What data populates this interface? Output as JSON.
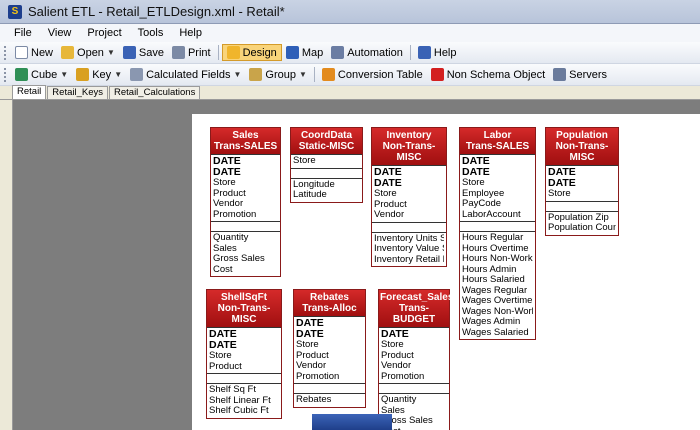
{
  "window": {
    "title": "Salient ETL - Retail_ETLDesign.xml - Retail*"
  },
  "menu": [
    "File",
    "View",
    "Project",
    "Tools",
    "Help"
  ],
  "toolbar1": [
    {
      "label": "New",
      "icon": "new-icon",
      "color": "#ffffff"
    },
    {
      "label": "Open",
      "icon": "open-icon",
      "color": "#e7b73a",
      "dropdown": true
    },
    {
      "label": "Save",
      "icon": "save-icon",
      "color": "#3a62b5"
    },
    {
      "label": "Print",
      "icon": "print-icon",
      "color": "#7c8aa5"
    },
    {
      "label": "Design",
      "icon": "design-icon",
      "color": "#f0b52c",
      "active": true
    },
    {
      "label": "Map",
      "icon": "map-icon",
      "color": "#2f5fb8"
    },
    {
      "label": "Automation",
      "icon": "automation-icon",
      "color": "#6b7da3"
    },
    {
      "label": "Help",
      "icon": "help-icon",
      "color": "#3a62b5"
    }
  ],
  "toolbar2": [
    {
      "label": "Cube",
      "icon": "cube-icon",
      "color": "#2f8f56",
      "dropdown": true
    },
    {
      "label": "Key",
      "icon": "key-icon",
      "color": "#d9a021",
      "dropdown": true
    },
    {
      "label": "Calculated Fields",
      "icon": "calculated-fields-icon",
      "color": "#8a97b0",
      "dropdown": true
    },
    {
      "label": "Group",
      "icon": "group-icon",
      "color": "#c9a44a",
      "dropdown": true
    },
    {
      "label": "Conversion Table",
      "icon": "conversion-table-icon",
      "color": "#e38b1e"
    },
    {
      "label": "Non Schema Object",
      "icon": "non-schema-object-icon",
      "color": "#d31f1f"
    },
    {
      "label": "Servers",
      "icon": "servers-icon",
      "color": "#6a7b9c"
    }
  ],
  "tabs": [
    "Retail",
    "Retail_Keys",
    "Retail_Calculations"
  ],
  "tables": [
    {
      "title1": "Sales",
      "title2": "Trans-SALES",
      "bold": [
        "DATE",
        "DATE"
      ],
      "keys": [
        "Store",
        "Product",
        "Vendor",
        "Promotion"
      ],
      "measures": [
        "Quantity",
        "Sales",
        "Gross Sales",
        "Cost"
      ]
    },
    {
      "title1": "CoordData",
      "title2": "Static-MISC",
      "bold": [],
      "keys": [
        "Store"
      ],
      "measures": [
        "Longitude",
        "Latitude"
      ]
    },
    {
      "title1": "Inventory",
      "title2": "Non-Trans-MISC",
      "bold": [
        "DATE",
        "DATE"
      ],
      "keys": [
        "Store",
        "Product",
        "Vendor"
      ],
      "measures": [
        "Inventory Units Shelf",
        "Inventory Value Shelf",
        "Inventory Retail Price"
      ]
    },
    {
      "title1": "Labor",
      "title2": "Trans-SALES",
      "bold": [
        "DATE",
        "DATE"
      ],
      "keys": [
        "Store",
        "Employee",
        "PayCode",
        "LaborAccount"
      ],
      "measures": [
        "Hours Regular",
        "Hours Overtime",
        "Hours Non-Worked",
        "Hours Admin",
        "Hours Salaried",
        "Wages Regular",
        "Wages Overtime",
        "Wages Non-Worked",
        "Wages Admin",
        "Wages Salaried"
      ]
    },
    {
      "title1": "Population",
      "title2": "Non-Trans-MISC",
      "bold": [
        "DATE",
        "DATE"
      ],
      "keys": [
        "Store"
      ],
      "measures": [
        "Population Zip",
        "Population County"
      ]
    },
    {
      "title1": "ShellSqFt",
      "title2": "Non-Trans-MISC",
      "bold": [
        "DATE",
        "DATE"
      ],
      "keys": [
        "Store",
        "Product"
      ],
      "measures": [
        "Shelf Sq Ft",
        "Shelf Linear Ft",
        "Shelf Cubic Ft"
      ]
    },
    {
      "title1": "Rebates",
      "title2": "Trans-Alloc",
      "bold": [
        "DATE",
        "DATE"
      ],
      "keys": [
        "Store",
        "Product",
        "Vendor",
        "Promotion"
      ],
      "measures": [
        "Rebates"
      ]
    },
    {
      "title1": "Forecast_Sales",
      "title2": "Trans-BUDGET",
      "bold": [
        "DATE"
      ],
      "keys": [
        "Store",
        "Product",
        "Vendor",
        "Promotion"
      ],
      "measures": [
        "Quantity",
        "Sales",
        "Gross Sales",
        "Cost"
      ]
    }
  ]
}
